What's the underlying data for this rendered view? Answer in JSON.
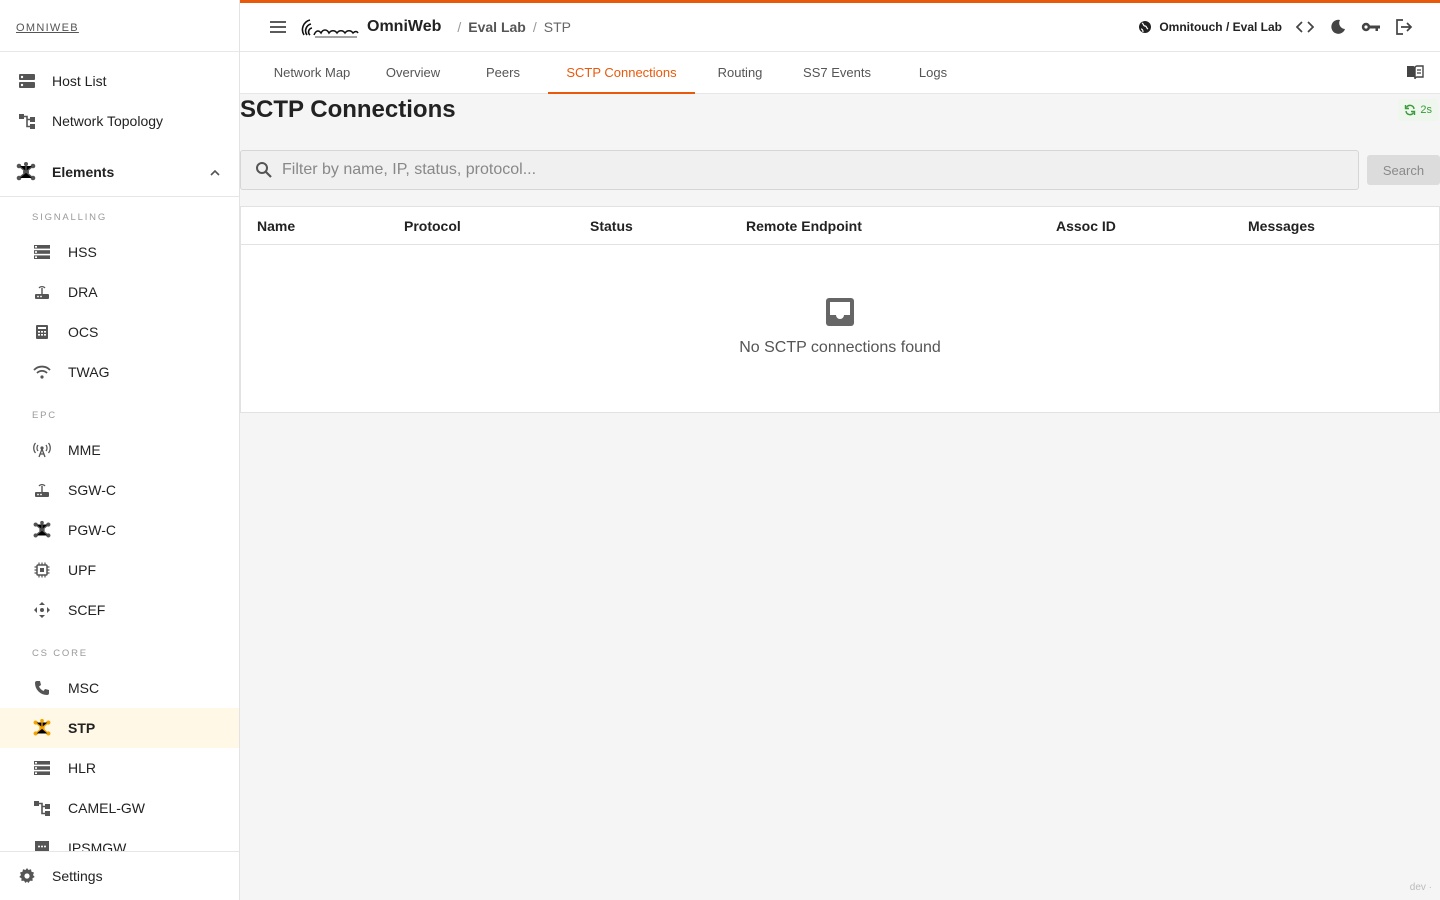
{
  "sidebar": {
    "logo_text": "OMNIWEB",
    "top_items": [
      {
        "label": "Host List",
        "icon": "server-icon"
      },
      {
        "label": "Network Topology",
        "icon": "topology-icon"
      }
    ],
    "group": {
      "label": "Elements",
      "icon": "hub-icon",
      "expanded": true
    },
    "sections": [
      {
        "title": "SIGNALLING",
        "items": [
          {
            "label": "HSS",
            "icon": "storage-icon"
          },
          {
            "label": "DRA",
            "icon": "router-icon"
          },
          {
            "label": "OCS",
            "icon": "billing-icon"
          },
          {
            "label": "TWAG",
            "icon": "wifi-icon"
          }
        ]
      },
      {
        "title": "EPC",
        "items": [
          {
            "label": "MME",
            "icon": "antenna-icon"
          },
          {
            "label": "SGW-C",
            "icon": "router-icon"
          },
          {
            "label": "PGW-C",
            "icon": "hub-icon"
          },
          {
            "label": "UPF",
            "icon": "chip-icon"
          },
          {
            "label": "SCEF",
            "icon": "move-icon"
          }
        ]
      },
      {
        "title": "CS CORE",
        "items": [
          {
            "label": "MSC",
            "icon": "phone-icon"
          },
          {
            "label": "STP",
            "icon": "hub-icon",
            "active": true
          },
          {
            "label": "HLR",
            "icon": "storage-icon"
          },
          {
            "label": "CAMEL-GW",
            "icon": "topology-icon"
          },
          {
            "label": "IPSMGW",
            "icon": "sms-icon"
          }
        ]
      }
    ],
    "settings_label": "Settings"
  },
  "header": {
    "brand": "OmniWeb",
    "breadcrumb": [
      "Eval Lab",
      "STP"
    ],
    "org": "Omnitouch / Eval Lab",
    "accent": "#e8590c"
  },
  "tabs": [
    {
      "label": "Network Map"
    },
    {
      "label": "Overview"
    },
    {
      "label": "Peers"
    },
    {
      "label": "SCTP Connections",
      "active": true
    },
    {
      "label": "Routing"
    },
    {
      "label": "SS7 Events"
    },
    {
      "label": "Logs"
    }
  ],
  "main": {
    "title": "SCTP Connections",
    "refresh_interval": "2s",
    "search_placeholder": "Filter by name, IP, status, protocol...",
    "search_button": "Search",
    "columns": [
      "Name",
      "Protocol",
      "Status",
      "Remote Endpoint",
      "Assoc ID",
      "Messages"
    ],
    "empty_message": "No SCTP connections found"
  },
  "footer": {
    "env": "dev ·"
  }
}
